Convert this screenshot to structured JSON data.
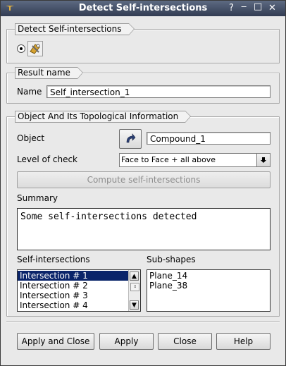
{
  "window": {
    "title": "Detect Self-intersections",
    "help_glyph": "?",
    "close_glyph": "✕",
    "maximize_glyph": "□",
    "minimize_glyph": "‒"
  },
  "detect_group": {
    "title": "Detect Self-intersections",
    "radio_selected": true,
    "icon": "self-intersection-tool-icon"
  },
  "result_group": {
    "title": "Result name",
    "name_label": "Name",
    "name_value": "Self_intersection_1"
  },
  "object_group": {
    "title": "Object And Its Topological Information",
    "object_label": "Object",
    "object_value": "Compound_1",
    "select_icon": "arrow-select-icon",
    "level_label": "Level of check",
    "level_value": "Face to Face + all above",
    "compute_label": "Compute self-intersections",
    "summary_label": "Summary",
    "summary_text": "Some self-intersections detected",
    "intersections_label": "Self-intersections",
    "intersections": [
      "Intersection # 1",
      "Intersection # 2",
      "Intersection # 3",
      "Intersection # 4"
    ],
    "selected_intersection": 0,
    "subshapes_label": "Sub-shapes",
    "subshapes": [
      "Plane_14",
      "Plane_38"
    ]
  },
  "buttons": {
    "apply_close": "Apply and Close",
    "apply": "Apply",
    "close": "Close",
    "help": "Help"
  },
  "colors": {
    "selection": "#0a246a",
    "titlebar": "#3d4860"
  }
}
